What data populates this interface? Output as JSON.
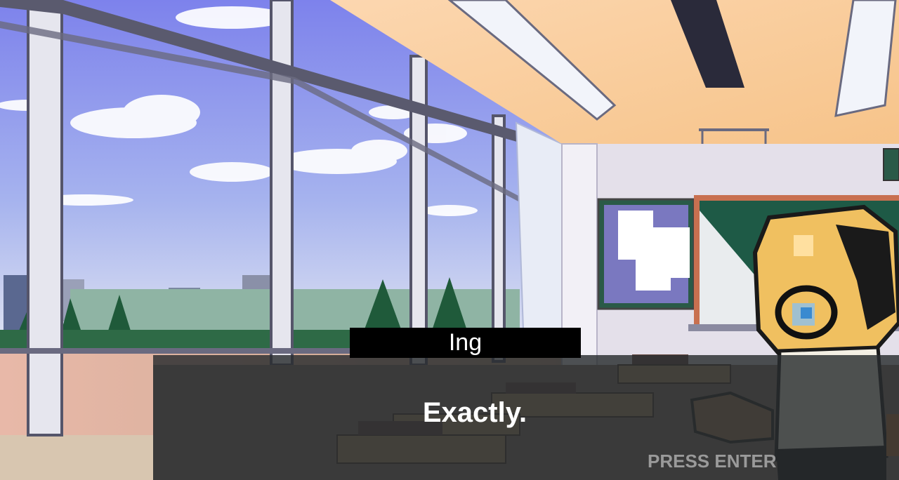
{
  "dialogue": {
    "speaker": "Ing",
    "line": "Exactly.",
    "prompt": "PRESS ENTER"
  },
  "scene": {
    "setting": "classroom",
    "sky_color": "#8a8ff0",
    "ceiling_color": "#f8c890",
    "board_color": "#1e5a46"
  },
  "character": {
    "hair_color": "#f0c060",
    "shirt_color": "#f4f0e4"
  }
}
